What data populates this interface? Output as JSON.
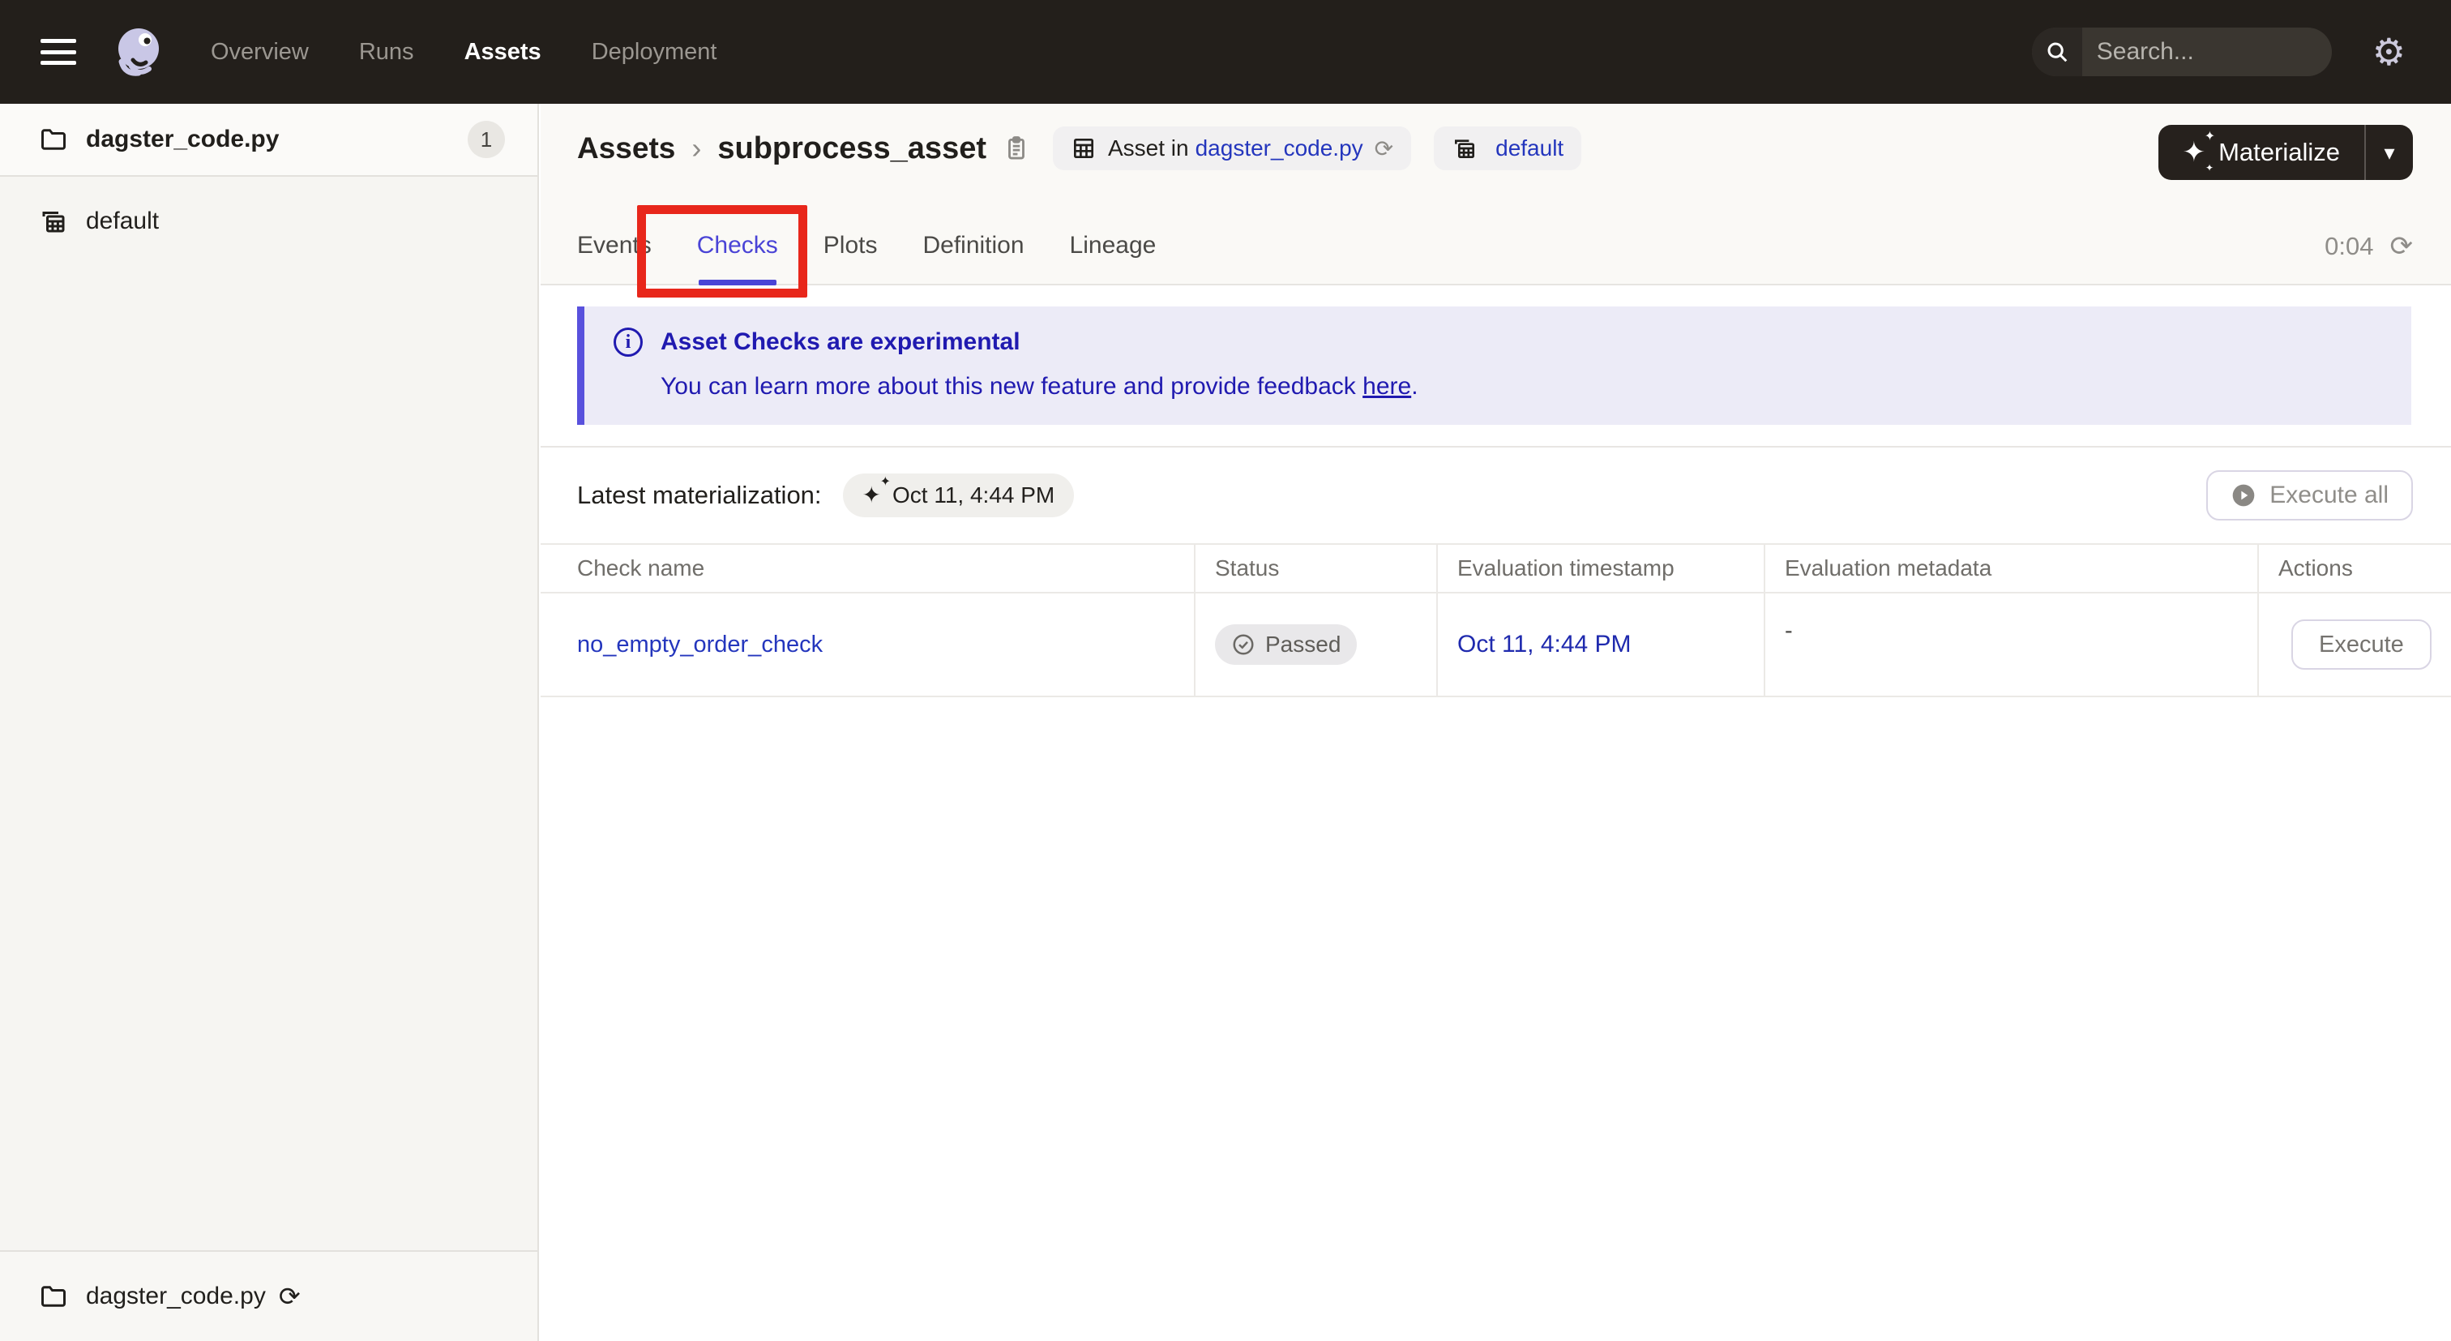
{
  "topnav": {
    "links": [
      "Overview",
      "Runs",
      "Assets",
      "Deployment"
    ],
    "search_placeholder": "Search...",
    "search_shortcut": "/"
  },
  "sidebar": {
    "top_item": {
      "label": "dagster_code.py",
      "count": "1"
    },
    "group_item": {
      "label": "default"
    },
    "bottom_item": {
      "label": "dagster_code.py"
    }
  },
  "header": {
    "breadcrumb_root": "Assets",
    "asset_name": "subprocess_asset",
    "tag_asset_prefix": "Asset in",
    "tag_asset_link": "dagster_code.py",
    "tag_group": "default",
    "materialize_label": "Materialize"
  },
  "tabs": {
    "items": [
      "Events",
      "Checks",
      "Plots",
      "Definition",
      "Lineage"
    ],
    "active": "Checks",
    "timer": "0:04"
  },
  "banner": {
    "title": "Asset Checks are experimental",
    "body": "You can learn more about this new feature and provide feedback ",
    "link_text": "here",
    "period": "."
  },
  "latest": {
    "label": "Latest materialization:",
    "value": "Oct 11, 4:44 PM",
    "execute_all_label": "Execute all"
  },
  "table": {
    "headers": [
      "Check name",
      "Status",
      "Evaluation timestamp",
      "Evaluation metadata",
      "Actions"
    ],
    "rows": [
      {
        "name": "no_empty_order_check",
        "status": "Passed",
        "timestamp": "Oct 11, 4:44 PM",
        "metadata": "-",
        "action": "Execute"
      }
    ]
  },
  "icons": {
    "sparkle": "✦",
    "sparkle_mini": "✦",
    "caret_down": "▾",
    "chevron": "›",
    "refresh": "⟳",
    "gear": "⚙",
    "slash": "/",
    "info": "i"
  },
  "colors": {
    "nav_bg": "#231f1b",
    "accent_blurple": "#4a44d6",
    "link_blue": "#2436bd",
    "banner_text": "#201ab0",
    "banner_bg": "#ecebf7",
    "annotation_red": "#e8271b"
  }
}
